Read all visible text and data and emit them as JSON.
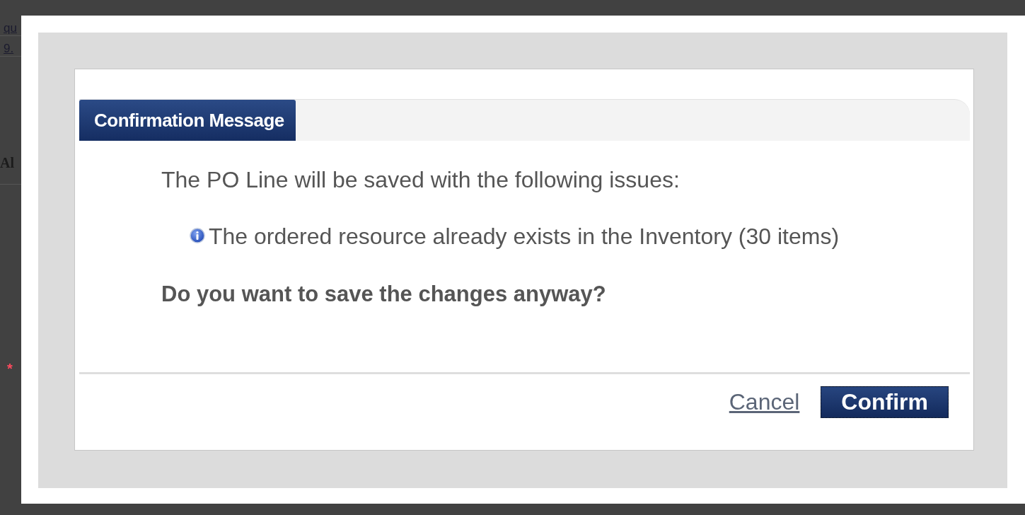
{
  "background_page": {
    "fragments": [
      {
        "text": "qu",
        "kind": "link"
      },
      {
        "text": "9.",
        "kind": "link"
      },
      {
        "text": "Al",
        "kind": "heading"
      },
      {
        "text": "*",
        "kind": "required"
      }
    ]
  },
  "dialog": {
    "title": "Confirmation Message",
    "message": "The PO Line will be saved with the following issues:",
    "issues": [
      {
        "text": "The ordered resource already exists in the Inventory (30 items)",
        "kind": "info"
      }
    ],
    "question": "Do you want to save the changes anyway?",
    "buttons": [
      {
        "label": "Cancel",
        "kind": "link"
      },
      {
        "label": "Confirm",
        "kind": "primary"
      }
    ]
  }
}
